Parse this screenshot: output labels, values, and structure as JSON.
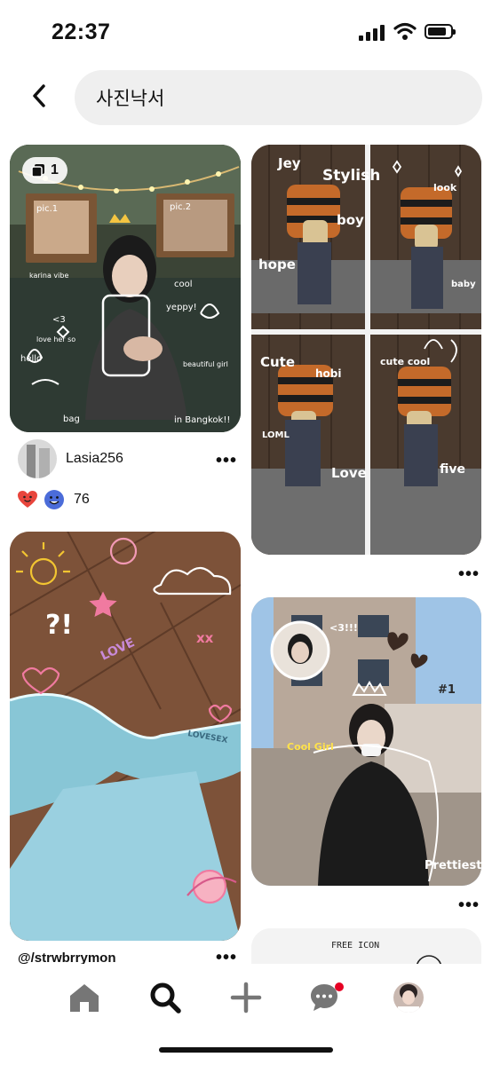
{
  "status_bar": {
    "time": "22:37"
  },
  "search": {
    "query": "사진낙서"
  },
  "pins": [
    {
      "page_count": "1",
      "doodle_texts": [
        "pic.1",
        "pic.2",
        "karina vibe",
        "cool",
        "yeppy!",
        "<3",
        "love her so",
        "hello",
        "beautiful girl",
        "bag",
        "in Bangkok!!"
      ],
      "user": "Lasia256",
      "reaction_count": "76"
    },
    {
      "doodle_texts": [
        "Jey",
        "Stylish",
        "boy",
        "hope",
        "look",
        "baby",
        "Cute",
        "hobi",
        "cute cool",
        "LOML",
        "Love",
        "five"
      ]
    },
    {
      "doodle_texts": [
        "?!",
        "LOVE",
        "xx",
        "LOVESEX"
      ],
      "source": "@/strwbrrymon"
    },
    {
      "doodle_texts": [
        "<3!!!",
        "Cool Girl",
        "Prettiest",
        "#1"
      ]
    },
    {
      "doodle_texts": [
        "FREE ICON"
      ]
    }
  ],
  "tabs": [
    "home",
    "search",
    "create",
    "messages",
    "profile"
  ],
  "colors": {
    "accent": "#e60023",
    "search_bg": "#efefef"
  }
}
